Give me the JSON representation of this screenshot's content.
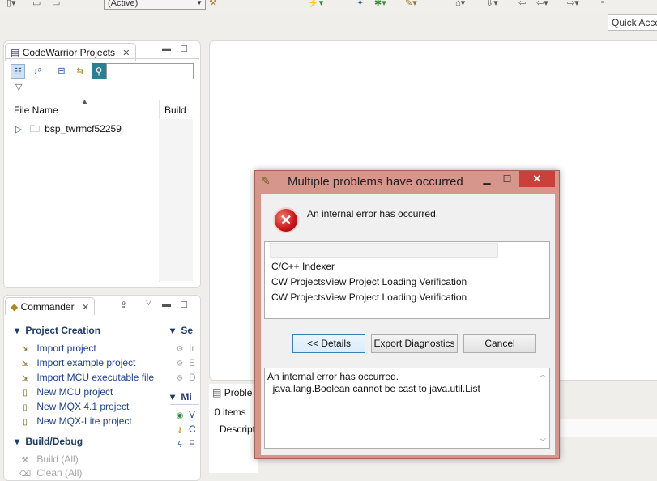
{
  "toolbar": {
    "active_config": "(Active)",
    "quick_access": "Quick Access"
  },
  "projects_panel": {
    "tab_label": "CodeWarrior Projects",
    "columns": [
      "File Name",
      "Build"
    ],
    "items": [
      {
        "label": "bsp_twrmcf52259"
      }
    ]
  },
  "commander_panel": {
    "tab_label": "Commander",
    "section1": {
      "title": "Project Creation",
      "items": [
        "Import project",
        "Import example project",
        "Import MCU executable file",
        "New MCU project",
        "New MQX 4.1 project",
        "New MQX-Lite project"
      ]
    },
    "section2": {
      "title": "Build/Debug",
      "items": [
        "Build   (All)",
        "Clean   (All)"
      ]
    },
    "right_col": {
      "section_a": "Se",
      "items_a": [
        "Ir",
        "E",
        "D"
      ],
      "section_b": "Mi",
      "items_b": [
        "V",
        "C",
        "F"
      ]
    }
  },
  "problems_panel": {
    "tab_label": "Proble",
    "count": "0 items",
    "col_header": "Descript"
  },
  "dialog": {
    "title": "Multiple problems have occurred",
    "message": "An internal error has occurred.",
    "problems": [
      "C/C++ Indexer",
      "CW ProjectsView Project Loading Verification",
      "CW ProjectsView Project Loading Verification"
    ],
    "buttons": {
      "details": "<< Details",
      "export": "Export Diagnostics",
      "cancel": "Cancel"
    },
    "details_text": "An internal error has occurred.\n  java.lang.Boolean cannot be cast to java.util.List"
  }
}
